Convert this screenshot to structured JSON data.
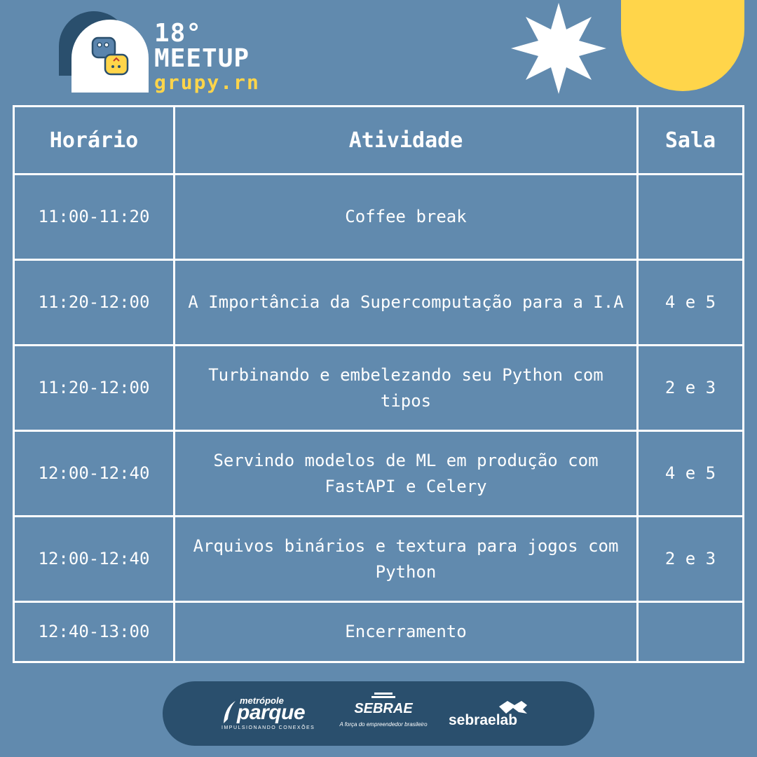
{
  "header": {
    "title_line1": "18°",
    "title_line2": "MEETUP",
    "subtitle": "grupy.rn",
    "logo_icon": "python-logo-icon",
    "colors": {
      "background": "#618aae",
      "dark": "#2a4f6d",
      "accent": "#ffd54a"
    }
  },
  "table": {
    "columns": [
      "Horário",
      "Atividade",
      "Sala"
    ],
    "rows": [
      {
        "time": "11:00-11:20",
        "activity": "Coffee break",
        "room": ""
      },
      {
        "time": "11:20-12:00",
        "activity": "A Importância da Supercomputação para a I.A",
        "room": "4 e 5"
      },
      {
        "time": "11:20-12:00",
        "activity": "Turbinando e embelezando seu Python com tipos",
        "room": "2 e 3"
      },
      {
        "time": "12:00-12:40",
        "activity": "Servindo modelos de ML em produção com FastAPI e Celery",
        "room": "4 e 5"
      },
      {
        "time": "12:00-12:40",
        "activity": "Arquivos binários e textura para jogos com Python",
        "room": "2 e 3"
      },
      {
        "time": "12:40-13:00",
        "activity": "Encerramento",
        "room": ""
      }
    ]
  },
  "sponsors": {
    "parque": {
      "top": "metrópole",
      "main": "parque",
      "tagline": "IMPULSIONANDO CONEXÕES"
    },
    "sebrae": {
      "main": "SEBRAE",
      "tagline": "A força do empreendedor brasileiro"
    },
    "sebraelab": {
      "main": "sebraelab"
    }
  }
}
